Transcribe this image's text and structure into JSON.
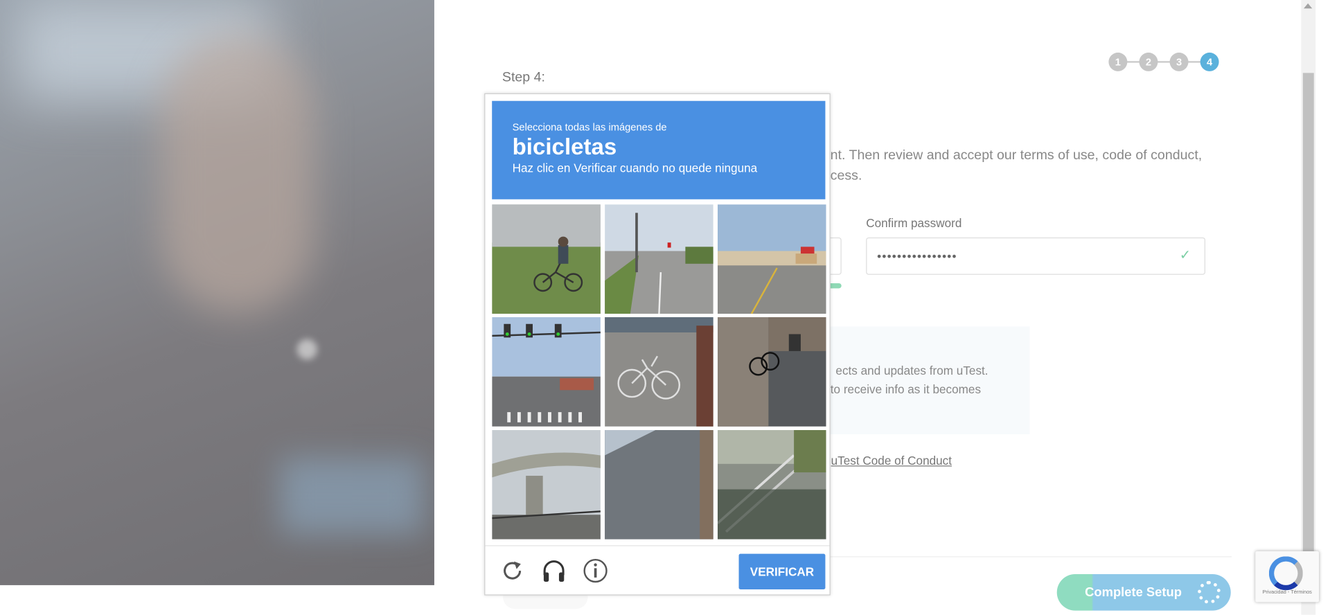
{
  "form": {
    "steps": [
      "1",
      "2",
      "3",
      "4"
    ],
    "active_step": "4",
    "step_label": "Step 4:",
    "intro_line1": "unt. Then review and accept our terms of use, code of conduct,",
    "intro_line2": "ocess.",
    "confirm_password_label": "Confirm password",
    "confirm_password_value": "••••••••••••••••",
    "optin_line1": "ects and updates from uTest.",
    "optin_line2": "to receive info as it becomes",
    "coc_prefix": "e ",
    "coc_link": "uTest Code of Conduct",
    "complete_button": "Complete Setup"
  },
  "captcha": {
    "instruction": "Selecciona todas las imágenes de",
    "target": "bicicletas",
    "hint": "Haz clic en Verificar cuando no quede ninguna",
    "tiles": [
      "person riding bicycle on sidewalk",
      "road with traffic light",
      "wide street with signs",
      "intersection with traffic lights",
      "parked bicycle on pavement",
      "bicycle near building",
      "highway overpass",
      "shingled roof",
      "exterior staircase"
    ],
    "verify_button": "VERIFICAR",
    "reload_icon": "reload-icon",
    "audio_icon": "headphones-icon",
    "info_icon": "info-icon"
  },
  "badge": {
    "terms": "Privacidad - Términos"
  },
  "colors": {
    "captcha_blue": "#4a90e2",
    "step_active": "#5ab1dc",
    "success_green": "#8fd9b5"
  }
}
